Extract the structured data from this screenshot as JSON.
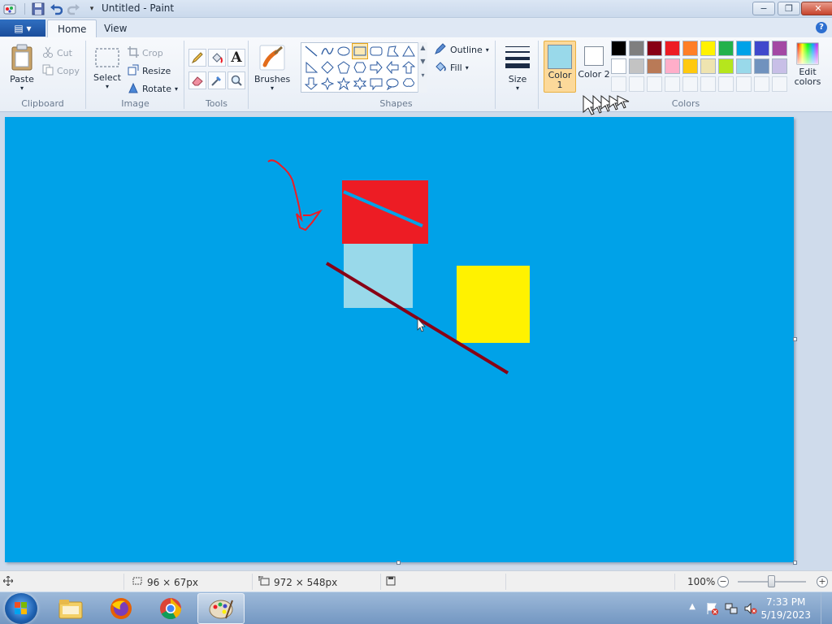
{
  "window": {
    "title": "Untitled - Paint",
    "minimize": "−",
    "maximize": "❐",
    "close": "✕"
  },
  "ribbon_tabs": {
    "file": "▤ ▾",
    "home": "Home",
    "view": "View",
    "help": "?"
  },
  "clipboard": {
    "paste": "Paste",
    "cut": "Cut",
    "copy": "Copy",
    "label": "Clipboard"
  },
  "image": {
    "select": "Select",
    "crop": "Crop",
    "resize": "Resize",
    "rotate": "Rotate",
    "label": "Image"
  },
  "tools": {
    "label": "Tools",
    "text_glyph": "A"
  },
  "brushes": {
    "label": "Brushes"
  },
  "shapes": {
    "outline": "Outline",
    "fill": "Fill",
    "label": "Shapes"
  },
  "size": {
    "label": "Size"
  },
  "colors": {
    "color1": "Color 1",
    "color1_value": "#99d9ea",
    "color2": "Color 2",
    "color2_value": "#ffffff",
    "edit": "Edit colors",
    "label": "Colors",
    "palette_row1": [
      "#000000",
      "#7f7f7f",
      "#880015",
      "#ed1c24",
      "#ff7f27",
      "#fff200",
      "#22b14c",
      "#00a2e8",
      "#3f48cc",
      "#a349a4"
    ],
    "palette_row2": [
      "#ffffff",
      "#c3c3c3",
      "#b97a57",
      "#ffaec9",
      "#ffc90e",
      "#efe4b0",
      "#b5e61d",
      "#99d9ea",
      "#7092be",
      "#c8bfe7"
    ]
  },
  "canvas": {
    "background": "#00a2e8",
    "red_rect": "#ed1c24",
    "light_rect": "#99d9ea",
    "yellow_rect": "#fff200",
    "dark_line": "#880015",
    "blue_line": "#00a2e8"
  },
  "statusbar": {
    "selection_size": "96 × 67px",
    "canvas_size": "972 × 548px",
    "zoom": "100%",
    "zoom_level": 100
  },
  "taskbar": {
    "time": "7:33 PM",
    "date": "5/19/2023",
    "apps": [
      "windows-explorer",
      "firefox",
      "chrome",
      "paint"
    ]
  }
}
